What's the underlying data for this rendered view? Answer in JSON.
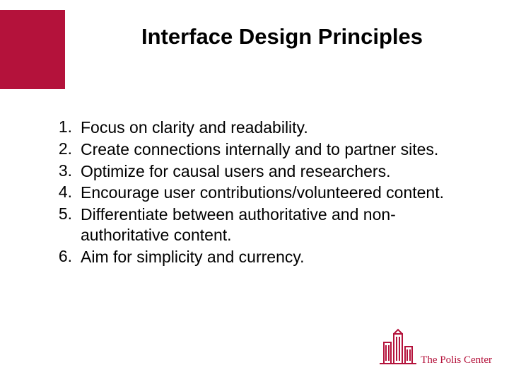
{
  "title": "Interface Design Principles",
  "items": [
    {
      "num": "1.",
      "text": "Focus on clarity and readability."
    },
    {
      "num": "2.",
      "text": "Create connections internally and to partner sites."
    },
    {
      "num": "3.",
      "text": "Optimize for causal users and researchers."
    },
    {
      "num": "4.",
      "text": "Encourage user contributions/volunteered content."
    },
    {
      "num": "5.",
      "text": "Differentiate between authoritative and non-authoritative content."
    },
    {
      "num": "6.",
      "text": "Aim for simplicity and currency."
    }
  ],
  "logo": {
    "text": "The Polis Center"
  },
  "colors": {
    "brand": "#b4123b"
  }
}
